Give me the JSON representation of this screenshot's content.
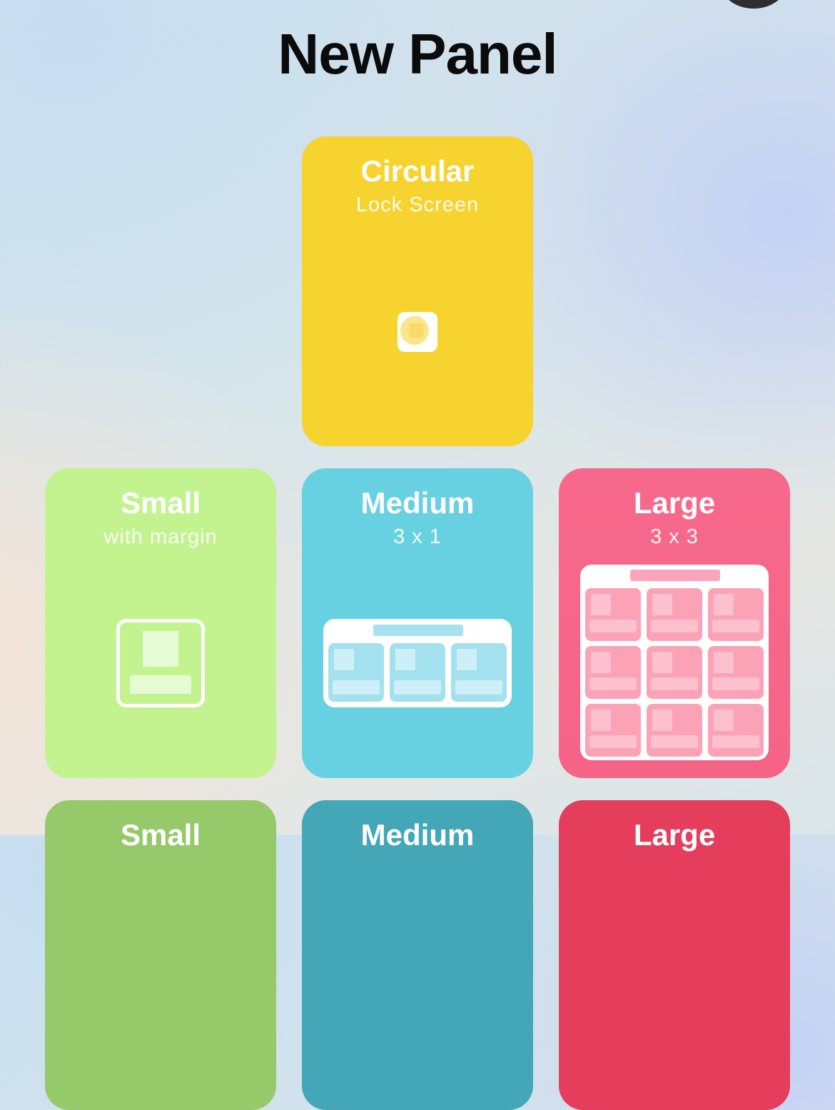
{
  "page": {
    "title": "New Panel"
  },
  "cards": [
    {
      "id": "circular",
      "name": "Circular",
      "subtitle": "Lock Screen",
      "color": "#F6D32E"
    },
    {
      "id": "small",
      "name": "Small",
      "subtitle": "with margin",
      "color": "#C3F38E"
    },
    {
      "id": "medium",
      "name": "Medium",
      "subtitle": "3 x 1",
      "color": "#68D1E1"
    },
    {
      "id": "large",
      "name": "Large",
      "subtitle": "3 x 3",
      "color": "#F5688B"
    },
    {
      "id": "small-2",
      "name": "Small",
      "subtitle": "",
      "color": "#96C96A"
    },
    {
      "id": "medium-2",
      "name": "Medium",
      "subtitle": "",
      "color": "#43A7B8"
    },
    {
      "id": "large-2",
      "name": "Large",
      "subtitle": "",
      "color": "#E53D5C"
    }
  ],
  "icons": {
    "close": "close-icon"
  }
}
